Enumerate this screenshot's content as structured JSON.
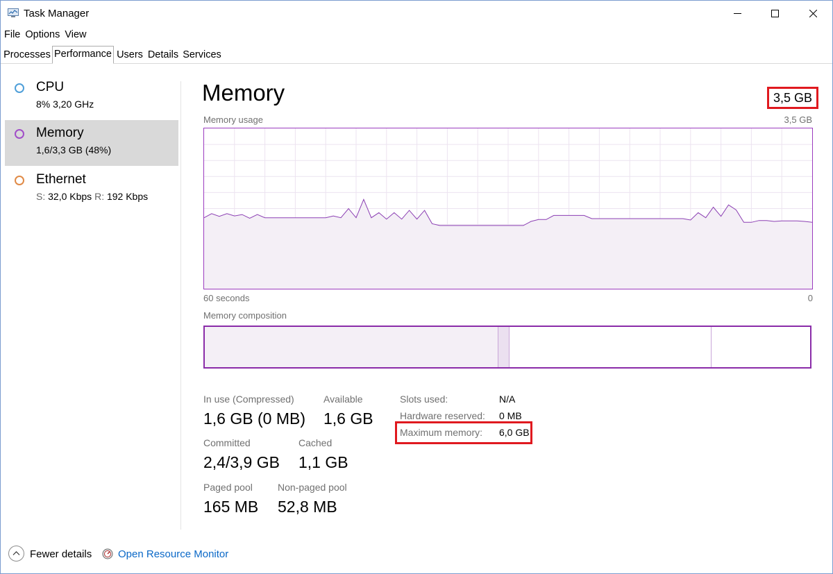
{
  "window": {
    "title": "Task Manager"
  },
  "menu": [
    "File",
    "Options",
    "View"
  ],
  "tabs": [
    "Processes",
    "Performance",
    "Users",
    "Details",
    "Services"
  ],
  "active_tab": "Performance",
  "sidebar": {
    "items": [
      {
        "title": "CPU",
        "sub": "8%  3,20 GHz",
        "color": "#4f9fd9"
      },
      {
        "title": "Memory",
        "sub": "1,6/3,3 GB (48%)",
        "color": "#a14ec8",
        "selected": true
      },
      {
        "title": "Ethernet",
        "s_label": "S:",
        "s_value": "32,0 Kbps",
        "r_label": "R:",
        "r_value": "192 Kbps",
        "color": "#e08a46"
      }
    ]
  },
  "main": {
    "title": "Memory",
    "total": "3,5 GB",
    "usage_label": "Memory usage",
    "usage_max": "3,5 GB",
    "time_left": "60 seconds",
    "time_right": "0",
    "composition_label": "Memory composition",
    "stats": {
      "in_use_label": "In use (Compressed)",
      "in_use_value": "1,6 GB (0 MB)",
      "available_label": "Available",
      "available_value": "1,6 GB",
      "committed_label": "Committed",
      "committed_value": "2,4/3,9 GB",
      "cached_label": "Cached",
      "cached_value": "1,1 GB",
      "paged_label": "Paged pool",
      "paged_value": "165 MB",
      "nonpaged_label": "Non-paged pool",
      "nonpaged_value": "52,8 MB"
    },
    "details": {
      "slots_label": "Slots used:",
      "slots_value": "N/A",
      "reserved_label": "Hardware reserved:",
      "reserved_value": "0 MB",
      "max_label": "Maximum memory:",
      "max_value": "6,0 GB"
    }
  },
  "colors": {
    "memory_line": "#8b3fb3",
    "memory_fill": "#f4eff6",
    "highlight": "#e0191f",
    "link": "#0a68c7"
  },
  "usage_series": [
    1.55,
    1.64,
    1.58,
    1.64,
    1.59,
    1.62,
    1.54,
    1.62,
    1.55,
    1.55,
    1.55,
    1.55,
    1.55,
    1.55,
    1.55,
    1.55,
    1.55,
    1.59,
    1.55,
    1.75,
    1.55,
    1.95,
    1.55,
    1.66,
    1.52,
    1.66,
    1.52,
    1.71,
    1.52,
    1.71,
    1.42,
    1.38,
    1.38,
    1.38,
    1.38,
    1.38,
    1.38,
    1.38,
    1.38,
    1.38,
    1.38,
    1.38,
    1.38,
    1.47,
    1.51,
    1.51,
    1.6,
    1.6,
    1.6,
    1.6,
    1.6,
    1.53,
    1.53,
    1.53,
    1.53,
    1.53,
    1.53,
    1.53,
    1.53,
    1.53,
    1.53,
    1.53,
    1.53,
    1.53,
    1.5,
    1.66,
    1.55,
    1.78,
    1.58,
    1.83,
    1.72,
    1.45,
    1.45,
    1.49,
    1.49,
    1.47,
    1.48,
    1.48,
    1.48,
    1.47,
    1.45
  ],
  "composition": {
    "in_use": 1.6,
    "modified": 0.06,
    "standby": 1.1,
    "free": 0.55,
    "total": 3.3
  },
  "bottom": {
    "fewer_details": "Fewer details",
    "open_monitor": "Open Resource Monitor"
  }
}
